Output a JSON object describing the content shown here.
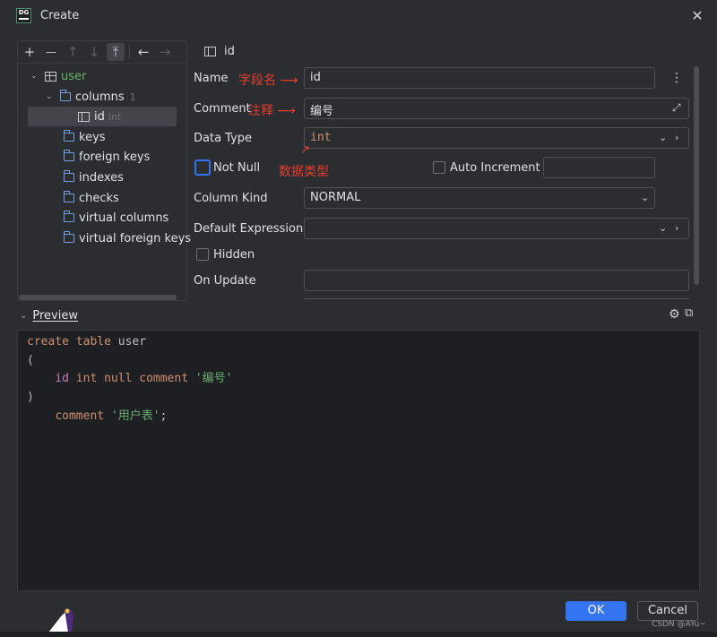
{
  "window": {
    "title": "Create",
    "logo_text": "DG"
  },
  "tree_toolbar": {
    "add_label": "+",
    "remove_label": "—",
    "move_up_label": "↑",
    "move_down_label": "↓",
    "move_top_label": "⤒",
    "back_label": "←",
    "forward_label": "→"
  },
  "tree": {
    "table": "user",
    "columns_label": "columns",
    "columns_count": "1",
    "column_name": "id",
    "column_type": "int",
    "folders": [
      "keys",
      "foreign keys",
      "indexes",
      "checks",
      "virtual columns",
      "virtual foreign keys"
    ]
  },
  "form": {
    "header": "id",
    "name_label": "Name",
    "name_value": "id",
    "comment_label": "Comment",
    "comment_value": "编号",
    "data_type_label": "Data Type",
    "data_type_value": "int",
    "not_null_label": "Not Null",
    "auto_increment_label": "Auto Increment",
    "column_kind_label": "Column Kind",
    "column_kind_value": "NORMAL",
    "default_expression_label": "Default Expression",
    "hidden_label": "Hidden",
    "on_update_label": "On Update"
  },
  "annotations": {
    "field_name": "字段名",
    "comment": "注释",
    "data_type": "数据类型"
  },
  "preview": {
    "title": "Preview",
    "line1_kw": "create table",
    "line1_name": "user",
    "line2": "(",
    "line3_name": "id",
    "line3_kw": "int null comment",
    "line3_str": "'编号'",
    "line4": ")",
    "line5_kw": "comment",
    "line5_str": "'用户表'",
    "line5_end": ";"
  },
  "buttons": {
    "ok": "OK",
    "cancel": "Cancel"
  },
  "watermark": "CSDN @AYu~",
  "colors": {
    "accent": "#3574f0",
    "annotation_red": "#e63d2e",
    "background": "#2b2d30",
    "editor_bg": "#1e1f22"
  }
}
